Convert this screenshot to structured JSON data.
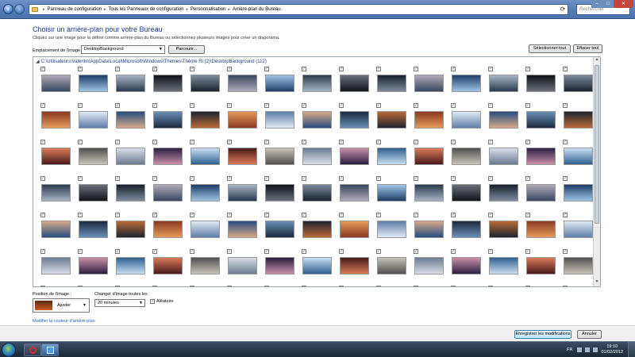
{
  "window": {
    "breadcrumbs": [
      "Panneau de configuration",
      "Tous les Panneaux de configuration",
      "Personnalisation",
      "Arrière-plan du Bureau"
    ],
    "search_placeholder": "Rechercher"
  },
  "page": {
    "heading": "Choisir un arrière-plan pour votre Bureau",
    "subheading": "Cliquez sur une image pour la définir comme arrière-plan du Bureau ou sélectionnez plusieurs images pour créer un diaporama.",
    "location_label": "Emplacement de l'image :",
    "location_value": "DesktopBackground",
    "browse_label": "Parcourir...",
    "select_all_label": "Sélectionner tout",
    "clear_all_label": "Effacer tout",
    "folder_path": "C:\\Utilisateurs\\Valentin\\AppData\\Local\\Microsoft\\Windows\\Themes\\Thème Ri (2)\\DesktopBackground (112)",
    "thumbnails": {
      "all_checked": true,
      "palette": [
        [
          "#3a4860",
          "#b0a9b8"
        ],
        [
          "#1b2a3f",
          "#6a8fb5"
        ],
        [
          "#51504f",
          "#c8c2b8"
        ],
        [
          "#1e3d66",
          "#9fc4e4"
        ],
        [
          "#1f2430",
          "#b86a38"
        ],
        [
          "#6d7c92",
          "#d8dde6"
        ],
        [
          "#2a3a4e",
          "#a7b4c4"
        ],
        [
          "#8a3a22",
          "#e39a5a"
        ],
        [
          "#2a1f3f",
          "#c890a8"
        ],
        [
          "#101318",
          "#6a6f78"
        ],
        [
          "#5e7ea8",
          "#dfe9f4"
        ],
        [
          "#2f5f8f",
          "#c8dff2"
        ],
        [
          "#19212c",
          "#7e8b9c"
        ],
        [
          "#2a4c80",
          "#d4a98a"
        ],
        [
          "#4a1a1a",
          "#d87a5a"
        ]
      ]
    }
  },
  "options": {
    "position_label": "Position de l'image :",
    "position_value": "Ajuster",
    "change_label": "Changer d'image toutes les :",
    "change_value": "20 minutes",
    "shuffle_label": "Aléatoire",
    "shuffle_checked": true,
    "color_link": "Modifier la couleur d'arrière-plan"
  },
  "footer": {
    "save_label": "Enregistrer les modifications",
    "cancel_label": "Annuler"
  },
  "taskbar": {
    "lang": "FR",
    "time": "19:10",
    "date": "01/02/2012"
  }
}
